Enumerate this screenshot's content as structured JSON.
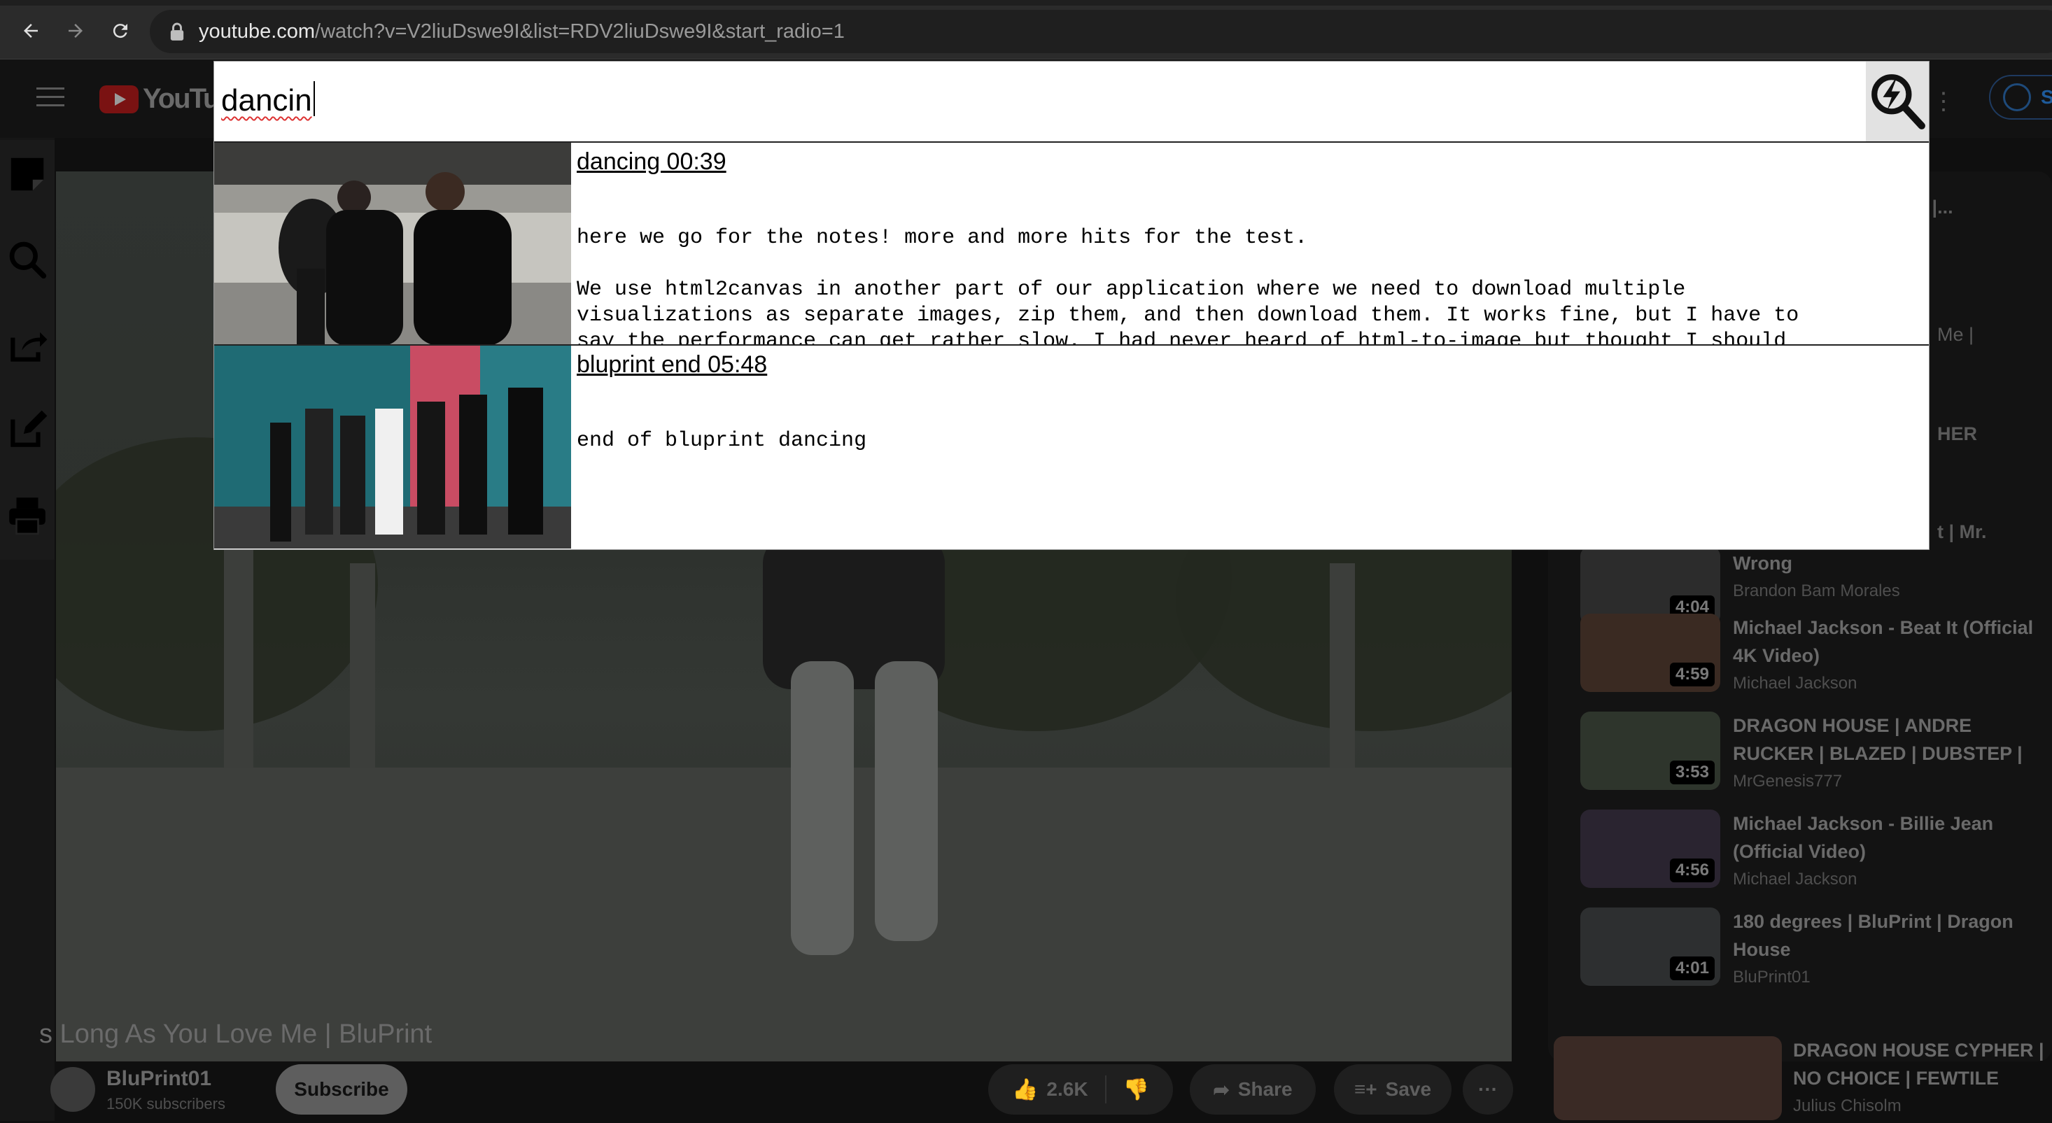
{
  "browser": {
    "url_host": "youtube.com",
    "url_path": "/watch?v=V2liuDswe9I&list=RDV2liuDswe9I&start_radio=1"
  },
  "youtube": {
    "logo_text": "YouTub",
    "signin_text": "Si",
    "video_title": "s Long As You Love Me | BluPrint",
    "channel_name": "BluPrint01",
    "channel_subs": "150K subscribers",
    "subscribe_label": "Subscribe",
    "like_count": "2.6K",
    "share_label": "Share",
    "save_label": "Save",
    "more_label": "···",
    "partial_titles": [
      "e |...",
      "Me |",
      "HER",
      "t | Mr."
    ],
    "recommendations": [
      {
        "title": "Wrong",
        "channel": "Brandon Bam Morales",
        "duration": "4:04"
      },
      {
        "title": "Michael Jackson - Beat It (Official 4K Video)",
        "channel": "Michael Jackson",
        "duration": "4:59"
      },
      {
        "title": "DRAGON HOUSE | ANDRE RUCKER | BLAZED | DUBSTEP |",
        "channel": "MrGenesis777",
        "duration": "3:53"
      },
      {
        "title": "Michael Jackson - Billie Jean (Official Video)",
        "channel": "Michael Jackson",
        "duration": "4:56"
      },
      {
        "title": "180 degrees | BluPrint | Dragon House",
        "channel": "BluPrint01",
        "duration": "4:01"
      }
    ],
    "bottom_rec": {
      "title": "DRAGON HOUSE CYPHER | NO CHOICE | FEWTILE",
      "channel": "Julius Chisolm"
    }
  },
  "extension": {
    "icons": [
      "note-icon",
      "search-icon",
      "share-icon",
      "edit-icon",
      "print-icon"
    ]
  },
  "search": {
    "query": "dancin",
    "results": [
      {
        "title": "dancing 00:39",
        "body": "here we go for the notes! more and more hits for the test.\n\nWe use html2canvas in another part of our application where we need to download multiple\nvisualizations as separate images, zip them, and then download them. It works fine, but I have to\nsay the performance can get rather slow. I had never heard of html-to-image but thought I should"
      },
      {
        "title": "bluprint end 05:48",
        "body": "end of bluprint dancing"
      }
    ]
  }
}
